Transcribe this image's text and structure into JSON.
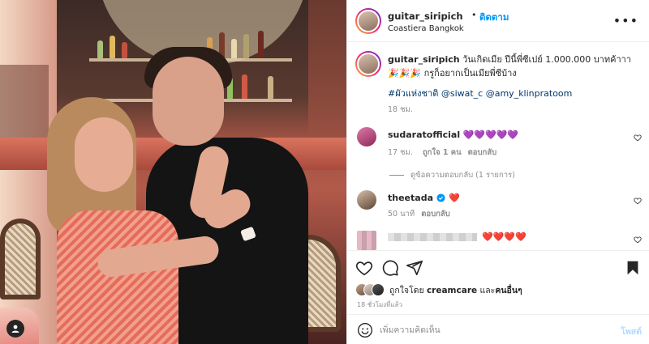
{
  "post": {
    "username": "guitar_siripich",
    "follow_label": "ติดตาม",
    "location": "Coastiera Bangkok",
    "more_label": "•••"
  },
  "caption": {
    "username": "guitar_siripich",
    "text": "วันเกิดเมีย ปีนี้พี่ซีเปย์ 1.000.000 บาทค้าาา",
    "line2_emoji": "🎉🎉🎉",
    "line2_text": "กรูก็อยากเป็นเมียพี่ซีบ้าง",
    "hashtag": "#ผัวแห่งชาติ",
    "mentions": "@siwat_c @amy_klinpratoom",
    "time": "18 ชม."
  },
  "comments": [
    {
      "username": "sudaratofficial",
      "text": "💜💜💜💜💜",
      "time": "17 ชม.",
      "likes": "ถูกใจ 1 คน",
      "reply": "ตอบกลับ",
      "view_replies": "ดูข้อความตอบกลับ (1 รายการ)"
    },
    {
      "username": "theetada",
      "text": "❤️",
      "time": "50 นาที",
      "reply": "ตอบกลับ"
    },
    {
      "username": "",
      "text": "❤️❤️❤️❤️"
    }
  ],
  "likes_line": {
    "prefix": "ถูกใจโดย",
    "name": "creamcare",
    "middle": "และ",
    "others": "คนอื่นๆ"
  },
  "time_ago": "18 ชั่วโมงที่แล้ว",
  "add_comment": {
    "placeholder": "เพิ่มความคิดเห็น",
    "post_label": "โพสต์"
  },
  "icons": {
    "more": "more-icon",
    "heart": "heart-icon",
    "comment": "comment-icon",
    "share": "share-icon",
    "save": "bookmark-icon",
    "emoji": "emoji-icon",
    "verified": "verified-icon",
    "tagged_user": "user-tag-icon"
  },
  "colors": {
    "link_blue": "#0095f6",
    "hashtag_blue": "#00376b",
    "meta_gray": "#8e8e8e",
    "post_disabled": "#b3dbff"
  }
}
